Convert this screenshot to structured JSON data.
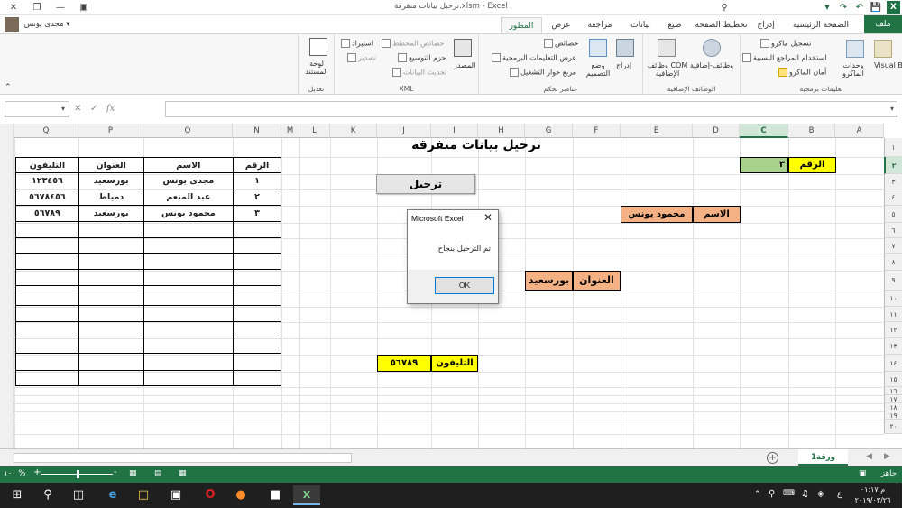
{
  "window": {
    "title": "ترحيل بيانات متفرقة.xlsm - Excel",
    "user_name": "مجدى يونس"
  },
  "tabs": [
    "ملف",
    "الصفحة الرئيسية",
    "إدراج",
    "تخطيط الصفحة",
    "صيغ",
    "بيانات",
    "مراجعة",
    "عرض",
    "المطور"
  ],
  "ribbon": {
    "groups": {
      "code": "تعليمات برمجية",
      "addins": "الوظائف الإضافية",
      "controls": "عناصر تحكم",
      "xml": "XML",
      "modify": "تعديل"
    },
    "items": {
      "visual_basic": "Visual Basic",
      "macros": "وحدات الماكرو",
      "record_macro": "تسجيل ماكرو",
      "relative_refs": "استخدام المراجع النسبية",
      "macro_security": "أمان الماكرو",
      "addins": "وظائف-إضافية",
      "com_addins": "وظائف COM الإضافية",
      "insert": "إدراج",
      "design_mode": "وضع التصميم",
      "properties": "خصائص",
      "view_code": "عرض التعليمات البرمجية",
      "run_dialog": "مربع حوار التشغيل",
      "source": "المصدر",
      "map_properties": "خصائص المخطط",
      "expansion_packs": "حزم التوسيع",
      "refresh_data": "تحديث البيانات",
      "import": "استيراد",
      "export": "تصدير",
      "doc_panel": "لوحة المستند"
    }
  },
  "formula_bar": {
    "name_box": "",
    "formula": ""
  },
  "grid": {
    "columns": [
      "A",
      "B",
      "C",
      "D",
      "E",
      "F",
      "G",
      "H",
      "I",
      "J",
      "K",
      "L",
      "M",
      "N",
      "O",
      "P",
      "Q"
    ],
    "selected_column": "C",
    "rows": [
      "١",
      "٢",
      "٣",
      "٤",
      "٥",
      "٦",
      "٧",
      "٨",
      "٩",
      "١٠",
      "١١",
      "١٢",
      "١٣",
      "١٤",
      "١٥",
      "١٦",
      "١٧",
      "١٨",
      "١٩",
      "٢٠"
    ],
    "selected_row": "٢"
  },
  "sheet": {
    "title": "ترحيل بيانات متفرقة",
    "transfer_button": "ترحيل",
    "number_label": "الرقم",
    "number_value": "٣",
    "name_label": "الاسم",
    "name_value": "محمود يونس",
    "address_label": "العنوان",
    "address_value": "بورسعيد",
    "phone_label": "التليفون",
    "phone_value": "٥٦٧٨٩"
  },
  "table": {
    "headers": [
      "الرقم",
      "الاسم",
      "العنوان",
      "التليفون"
    ],
    "rows": [
      [
        "١",
        "مجدى يونس",
        "بورسعيد",
        "١٢٣٤٥٦"
      ],
      [
        "٢",
        "عبد المنعم",
        "دمياط",
        "٥٦٧٨٤٥٦"
      ],
      [
        "٣",
        "محمود يونس",
        "بورسعيد",
        "٥٦٧٨٩"
      ]
    ],
    "empty_rows": 10
  },
  "dialog": {
    "title": "Microsoft Excel",
    "message": "تم الترحيل بنجاح",
    "ok_label": "OK"
  },
  "sheet_tabs": {
    "active": "ورقة1"
  },
  "status": {
    "zoom": "١٠٠ %",
    "ready": "جاهز"
  },
  "taskbar": {
    "time": "م ٠١:١٧",
    "date": "٢٠١٩/٠٣/٢٦"
  },
  "colors": {
    "excel_green": "#217346",
    "yellow": "#ffff00",
    "salmon": "#f4b183",
    "light_green": "#a9d18e"
  }
}
